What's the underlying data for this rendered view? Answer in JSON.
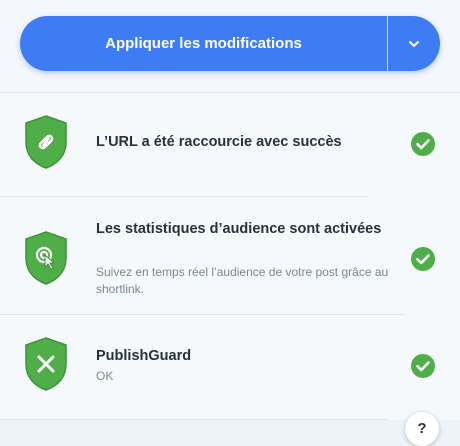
{
  "toolbar": {
    "apply_label": "Appliquer les modifications",
    "dropdown_icon": "chevron-down-icon",
    "accent_color": "#3d7cf3"
  },
  "checks": [
    {
      "title": "L’URL a été raccourcie avec succès",
      "subtitle": "",
      "icon": "link-icon",
      "status": "success"
    },
    {
      "title": "Les statistiques d’audience sont activées",
      "subtitle": "Suivez en temps réel l’audience de votre post grâce au shortlink.",
      "icon": "pointer-click-icon",
      "status": "success"
    },
    {
      "title": "PublishGuard",
      "subtitle": "OK",
      "icon": "x-icon",
      "status": "success"
    }
  ],
  "colors": {
    "shield_green": "#4fae48",
    "check_green": "#4fae48",
    "title_text": "#26323f",
    "subtitle_text": "#7b8794"
  },
  "help": {
    "label": "?"
  }
}
